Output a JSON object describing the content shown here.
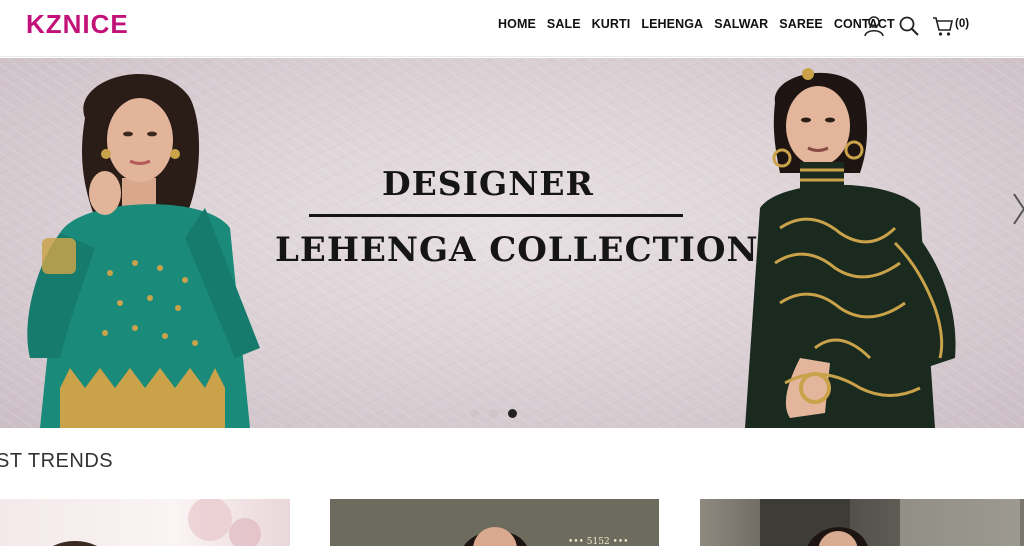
{
  "header": {
    "logo": "KZNICE",
    "nav": [
      "HOME",
      "SALE",
      "KURTI",
      "LEHENGA",
      "SALWAR",
      "SAREE",
      "CONTACT"
    ],
    "cart_count": "(0)",
    "icons": [
      "user-icon",
      "search-icon",
      "cart-icon"
    ]
  },
  "hero": {
    "title_line1": "DESIGNER",
    "title_line2": "LEHENGA COLLECTION",
    "slides": 3,
    "active_slide": 3
  },
  "section": {
    "title": "ST TRENDS"
  },
  "products": {
    "card2_text": "••• 5152 •••"
  },
  "colors": {
    "brand": "#c2127a",
    "left_model_dress": "#1a8a7a",
    "right_model_dress": "#1a2a1f",
    "gold": "#c9a24a"
  }
}
